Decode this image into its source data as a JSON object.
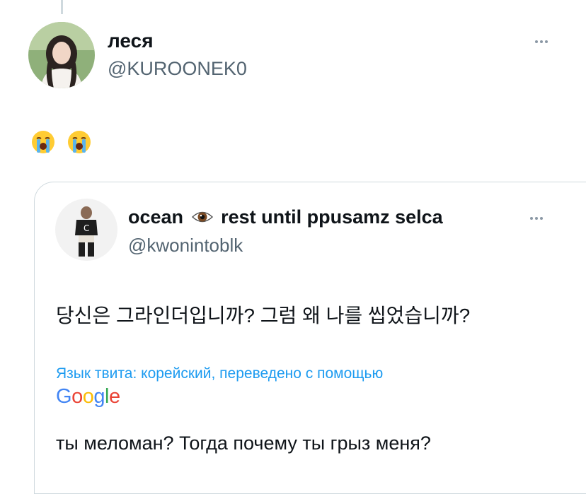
{
  "tweet": {
    "name": "леся",
    "handle": "@KUROONEK0",
    "emojis": [
      "loudly-crying-face",
      "loudly-crying-face"
    ]
  },
  "quoted": {
    "name": "ocean",
    "name_emoji": "eye-emoji",
    "name_suffix": "rest until ppusamz selca",
    "handle": "@kwonintoblk",
    "text": "당신은 그라인더입니까? 그럼 왜 나를 씹었습니까?",
    "language_note": "Язык твита: корейский, переведено с помощью",
    "translator_logo": [
      "G",
      "o",
      "o",
      "g",
      "l",
      "e"
    ],
    "translation": "ты меломан? Тогда почему ты грыз меня?"
  },
  "colors": {
    "link": "#1d9bf0",
    "text": "#0f1419",
    "secondary": "#536471",
    "border": "#cfd9de"
  }
}
